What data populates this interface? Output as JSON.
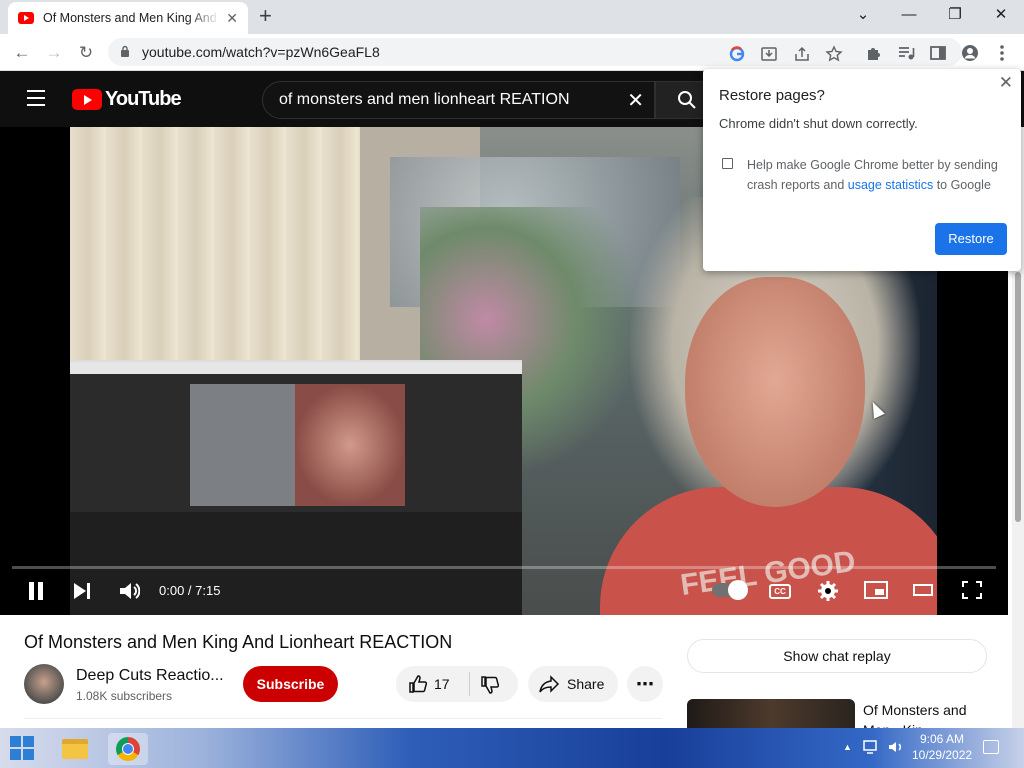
{
  "browser": {
    "tab_title": "Of Monsters and Men King And Lionheart REACTION - YouTube",
    "tab_close": "✕",
    "new_tab": "+",
    "window_controls": {
      "minimize": "—",
      "maximize": "❐",
      "close": "✕",
      "tab_search": "⌄"
    },
    "url": "youtube.com/watch?v=pzWn6GeaFL8",
    "nav": {
      "back": "←",
      "forward": "→",
      "reload": "↻"
    },
    "toolbar_icons": [
      "google-icon",
      "install-icon",
      "share-icon",
      "bookmark-star-icon",
      "extensions-icon",
      "media-icon",
      "side-panel-icon",
      "profile-icon",
      "menu-icon"
    ]
  },
  "youtube": {
    "logo_text": "YouTube",
    "search_query": "of monsters and men lionheart REATION",
    "search_clear": "✕"
  },
  "player": {
    "time_current": "0:00",
    "time_total": "7:15",
    "time_display": "0:00 / 7:15",
    "progress": 0,
    "cc_label": "CC",
    "shirt_print": "FEEL GOOD"
  },
  "video": {
    "title": "Of Monsters and Men King And Lionheart REACTION",
    "channel_name": "Deep Cuts Reactio...",
    "subscribers": "1.08K subscribers",
    "subscribe_label": "Subscribe",
    "like_count": "17",
    "share_label": "Share",
    "more_label": "⋯"
  },
  "sidebar": {
    "chat_replay_label": "Show chat replay",
    "related": [
      {
        "title": "Of Monsters and Men - Kin..."
      }
    ]
  },
  "restore_popup": {
    "title": "Restore pages?",
    "message": "Chrome didn't shut down correctly.",
    "checkbox_text_before": "Help make Google Chrome better by sending crash reports and ",
    "checkbox_link": "usage statistics",
    "checkbox_text_after": " to Google",
    "checked": false,
    "restore_label": "Restore",
    "close": "✕"
  },
  "taskbar": {
    "time": "9:06 AM",
    "date": "10/29/2022",
    "tray_chevron": "▲"
  }
}
